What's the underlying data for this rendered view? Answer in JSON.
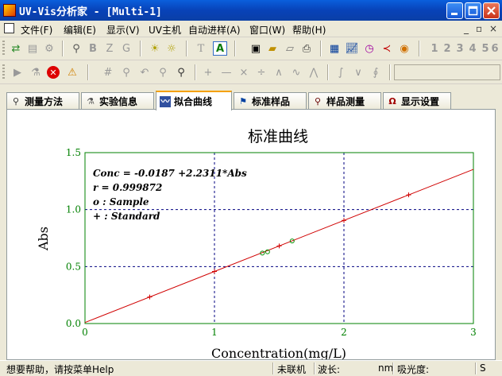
{
  "window": {
    "title": "UV-Vis分析家 - [Multi-1]"
  },
  "menu": {
    "items": [
      "文件(F)",
      "编辑(E)",
      "显示(V)",
      "UV主机",
      "自动进样(A)",
      "窗口(W)",
      "帮助(H)"
    ],
    "mdi_controls": [
      "_",
      "▫",
      "×"
    ]
  },
  "toolbar1": {
    "text_buttons": [
      "T",
      "A"
    ],
    "number_buttons": [
      "1",
      "2",
      "3",
      "4",
      "5",
      "6"
    ]
  },
  "tabs": [
    {
      "label": "测量方法",
      "icon": "wrench-icon",
      "active": false
    },
    {
      "label": "实验信息",
      "icon": "flask-icon",
      "active": false
    },
    {
      "label": "拟合曲线",
      "icon": "curve-icon",
      "active": true
    },
    {
      "label": "标准样品",
      "icon": "flag-icon",
      "active": false
    },
    {
      "label": "样品测量",
      "icon": "test-tube-icon",
      "active": false
    },
    {
      "label": "显示设置",
      "icon": "omega-icon",
      "active": false
    }
  ],
  "chart_data": {
    "type": "scatter",
    "title": "标准曲线",
    "xlabel": "Concentration(mg/L)",
    "ylabel": "Abs",
    "xlim": [
      0,
      3
    ],
    "ylim": [
      0,
      1.5
    ],
    "x_ticks": [
      "0",
      "1",
      "2",
      "3"
    ],
    "y_ticks": [
      "0.0",
      "0.5",
      "1.0",
      "1.5"
    ],
    "grid": true,
    "fit_line": {
      "equation": "Conc = -0.0187 +2.2311*Abs",
      "r": "r = 0.999872",
      "x_range": [
        0,
        3
      ]
    },
    "legend": [
      "o : Sample",
      "+ : Standard"
    ],
    "series": [
      {
        "name": "Standard",
        "marker": "+",
        "x": [
          0.5,
          1.0,
          1.5,
          2.0,
          2.5
        ],
        "y": [
          0.233,
          0.457,
          0.681,
          0.905,
          1.129
        ]
      },
      {
        "name": "Sample",
        "marker": "o",
        "x": [
          1.37,
          1.41,
          1.6
        ],
        "y": [
          0.618,
          0.63,
          0.725
        ]
      }
    ],
    "colors": {
      "line": "#d00000",
      "standard": "#d00000",
      "sample": "#009000",
      "grid": "#000080",
      "frame": "#008000"
    }
  },
  "status": {
    "help": "想要帮助，请按菜单Help",
    "connection": "未联机",
    "wavelength_label": "波长:",
    "wavelength_unit": "nm",
    "absorbance_label": "吸光度:",
    "mode": "S"
  }
}
